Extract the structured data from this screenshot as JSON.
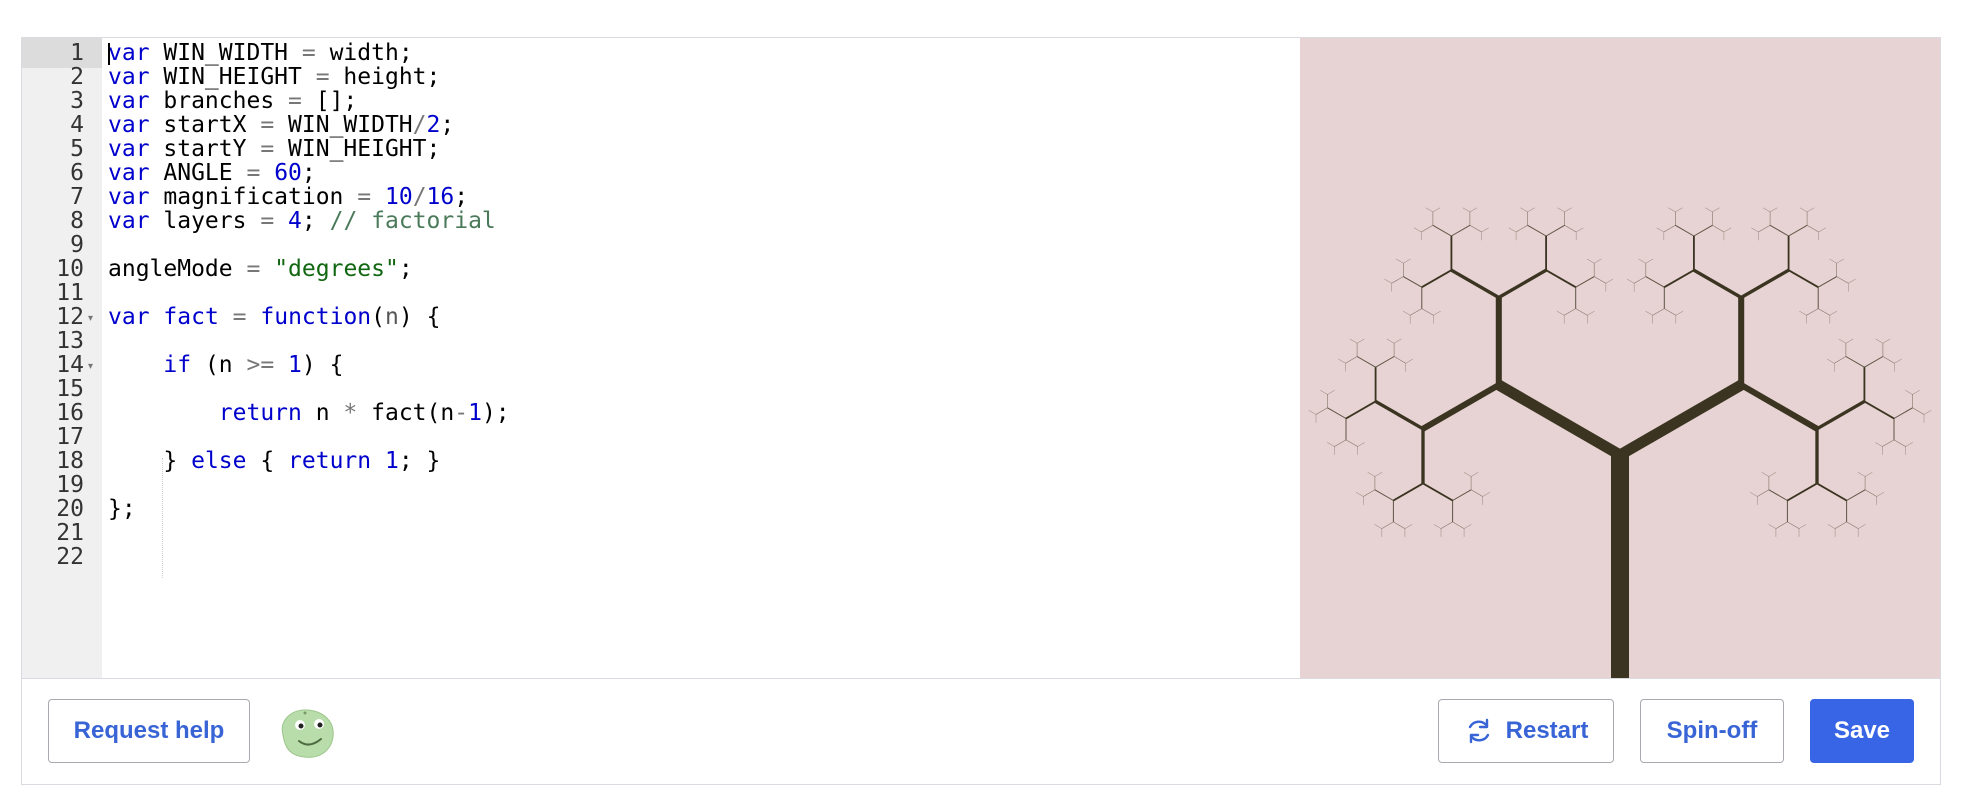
{
  "editor": {
    "lines": [
      {
        "n": "1"
      },
      {
        "n": "2"
      },
      {
        "n": "3"
      },
      {
        "n": "4"
      },
      {
        "n": "5"
      },
      {
        "n": "6"
      },
      {
        "n": "7"
      },
      {
        "n": "8"
      },
      {
        "n": "9"
      },
      {
        "n": "10"
      },
      {
        "n": "11"
      },
      {
        "n": "12"
      },
      {
        "n": "13"
      },
      {
        "n": "14"
      },
      {
        "n": "15"
      },
      {
        "n": "16"
      },
      {
        "n": "17"
      },
      {
        "n": "18"
      },
      {
        "n": "19"
      },
      {
        "n": "20"
      },
      {
        "n": "21"
      },
      {
        "n": "22"
      }
    ],
    "code": {
      "l1_kw": "var",
      "l1_rest": " WIN_WIDTH ",
      "l1_op": "=",
      "l1_end": " width;",
      "l2_kw": "var",
      "l2_rest": " WIN_HEIGHT ",
      "l2_op": "=",
      "l2_end": " height;",
      "l3_kw": "var",
      "l3_rest": " branches ",
      "l3_op": "=",
      "l3_end": " [];",
      "l4_kw": "var",
      "l4_rest": " startX ",
      "l4_op": "=",
      "l4_mid": " WIN_WIDTH",
      "l4_op2": "/",
      "l4_num": "2",
      "l4_end": ";",
      "l5_kw": "var",
      "l5_rest": " startY ",
      "l5_op": "=",
      "l5_end": " WIN_HEIGHT;",
      "l6_kw": "var",
      "l6_rest": " ANGLE ",
      "l6_op": "=",
      "l6_sp": " ",
      "l6_num": "60",
      "l6_end": ";",
      "l7_kw": "var",
      "l7_rest": " magnification ",
      "l7_op": "=",
      "l7_sp": " ",
      "l7_num1": "10",
      "l7_op2": "/",
      "l7_num2": "16",
      "l7_end": ";",
      "l8_kw": "var",
      "l8_rest": " layers ",
      "l8_op": "=",
      "l8_sp": " ",
      "l8_num": "4",
      "l8_end": "; ",
      "l8_com": "// factorial",
      "l10_rest": "angleMode ",
      "l10_op": "=",
      "l10_sp": " ",
      "l10_str": "\"degrees\"",
      "l10_end": ";",
      "l12_kw": "var",
      "l12_sp": " ",
      "l12_name": "fact",
      "l12_sp2": " ",
      "l12_op": "=",
      "l12_sp3": " ",
      "l12_fn": "function",
      "l12_p1": "(",
      "l12_arg": "n",
      "l12_end": ") {",
      "l14_ind": "    ",
      "l14_kw": "if",
      "l14_a": " (n ",
      "l14_op": ">=",
      "l14_sp": " ",
      "l14_num": "1",
      "l14_end": ") {",
      "l16_ind": "        ",
      "l16_kw": "return",
      "l16_a": " n ",
      "l16_op": "*",
      "l16_b": " fact(n",
      "l16_op2": "-",
      "l16_num": "1",
      "l16_end": ");",
      "l18_ind": "    ",
      "l18_a": "} ",
      "l18_kw": "else",
      "l18_b": " { ",
      "l18_kw2": "return",
      "l18_sp": " ",
      "l18_num": "1",
      "l18_end": "; }",
      "l20": "};"
    }
  },
  "canvas": {
    "background": "#e7d3d3",
    "branch_color": "#3a3420"
  },
  "footer": {
    "request_help_label": "Request help",
    "restart_label": "Restart",
    "spinoff_label": "Spin-off",
    "save_label": "Save",
    "accent": "#3864e6"
  }
}
